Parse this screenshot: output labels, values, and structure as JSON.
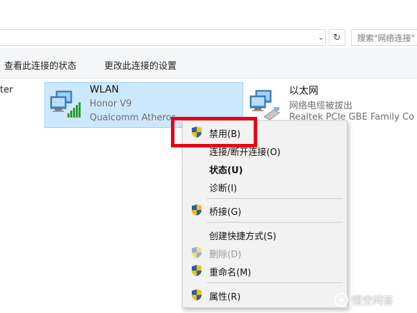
{
  "address_bar": {
    "search_placeholder": "搜索\"网络连接\""
  },
  "toolbar": {
    "view_status": "查看此连接的状态",
    "change_settings": "更改此连接的设置"
  },
  "left_fragment": "ter",
  "adapters": [
    {
      "name": "WLAN",
      "status": "Honor V9",
      "device": "Qualcomm Atheros",
      "icon": "wifi-adapter-icon",
      "selected": true
    },
    {
      "name": "以太网",
      "status": "网络电缆被拔出",
      "device": "Realtek PCIe GBE Family Co",
      "icon": "ethernet-adapter-icon",
      "selected": false
    }
  ],
  "context_menu": {
    "items": [
      {
        "label": "禁用(B)",
        "shield": true
      },
      {
        "label": "连接/断开连接(O)",
        "shield": false
      },
      {
        "label": "状态(U)",
        "shield": false,
        "bold": true
      },
      {
        "label": "诊断(I)",
        "shield": false
      },
      {
        "label": "桥接(G)",
        "shield": true
      },
      {
        "label": "创建快捷方式(S)",
        "shield": false
      },
      {
        "label": "删除(D)",
        "shield": true,
        "disabled": true
      },
      {
        "label": "重命名(M)",
        "shield": true
      },
      {
        "label": "属性(R)",
        "shield": true
      }
    ]
  },
  "highlight_color": "#e60012",
  "watermark": "悟空问答"
}
